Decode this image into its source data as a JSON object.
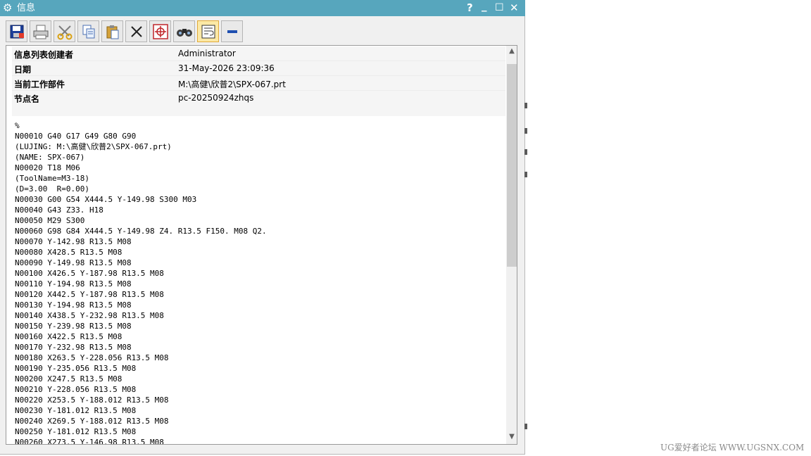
{
  "window": {
    "title": "信息",
    "gear_icon": "⚙",
    "help_glyph": "?",
    "minimize_glyph": "_",
    "maximize_glyph": "☐",
    "close_glyph": "✕"
  },
  "toolbar": {
    "icons": [
      "save-icon",
      "print-icon",
      "cut-icon",
      "copy-icon",
      "paste-icon",
      "delete-icon",
      "locate-icon",
      "find-icon",
      "word-wrap-icon",
      "collapse-icon"
    ]
  },
  "info": {
    "rows": [
      {
        "key": "信息列表创建者",
        "value": "Administrator"
      },
      {
        "key": "日期",
        "value": "31-May-2026 23:09:36"
      },
      {
        "key": "当前工作部件",
        "value": "M:\\高健\\欣普2\\SPX-067.prt"
      },
      {
        "key": "节点名",
        "value": "pc-20250924zhqs"
      }
    ]
  },
  "code": "%\nN00010 G40 G17 G49 G80 G90\n(LUJING: M:\\高健\\欣普2\\SPX-067.prt)\n(NAME: SPX-067)\nN00020 T18 M06\n(ToolName=M3-18)\n(D=3.00  R=0.00)\nN00030 G00 G54 X444.5 Y-149.98 S300 M03\nN00040 G43 Z33. H18\nN00050 M29 S300\nN00060 G98 G84 X444.5 Y-149.98 Z4. R13.5 F150. M08 Q2.\nN00070 Y-142.98 R13.5 M08\nN00080 X428.5 R13.5 M08\nN00090 Y-149.98 R13.5 M08\nN00100 X426.5 Y-187.98 R13.5 M08\nN00110 Y-194.98 R13.5 M08\nN00120 X442.5 Y-187.98 R13.5 M08\nN00130 Y-194.98 R13.5 M08\nN00140 X438.5 Y-232.98 R13.5 M08\nN00150 Y-239.98 R13.5 M08\nN00160 X422.5 R13.5 M08\nN00170 Y-232.98 R13.5 M08\nN00180 X263.5 Y-228.056 R13.5 M08\nN00190 Y-235.056 R13.5 M08\nN00200 X247.5 R13.5 M08\nN00210 Y-228.056 R13.5 M08\nN00220 X253.5 Y-188.012 R13.5 M08\nN00230 Y-181.012 R13.5 M08\nN00240 X269.5 Y-188.012 R13.5 M08\nN00250 Y-181.012 R13.5 M08\nN00260 X273.5 Y-146.98 R13.5 M08",
  "scrollbar": {
    "up_glyph": "▲",
    "down_glyph": "▼"
  },
  "watermark": "UG爱好者论坛 WWW.UGSNX.COM"
}
